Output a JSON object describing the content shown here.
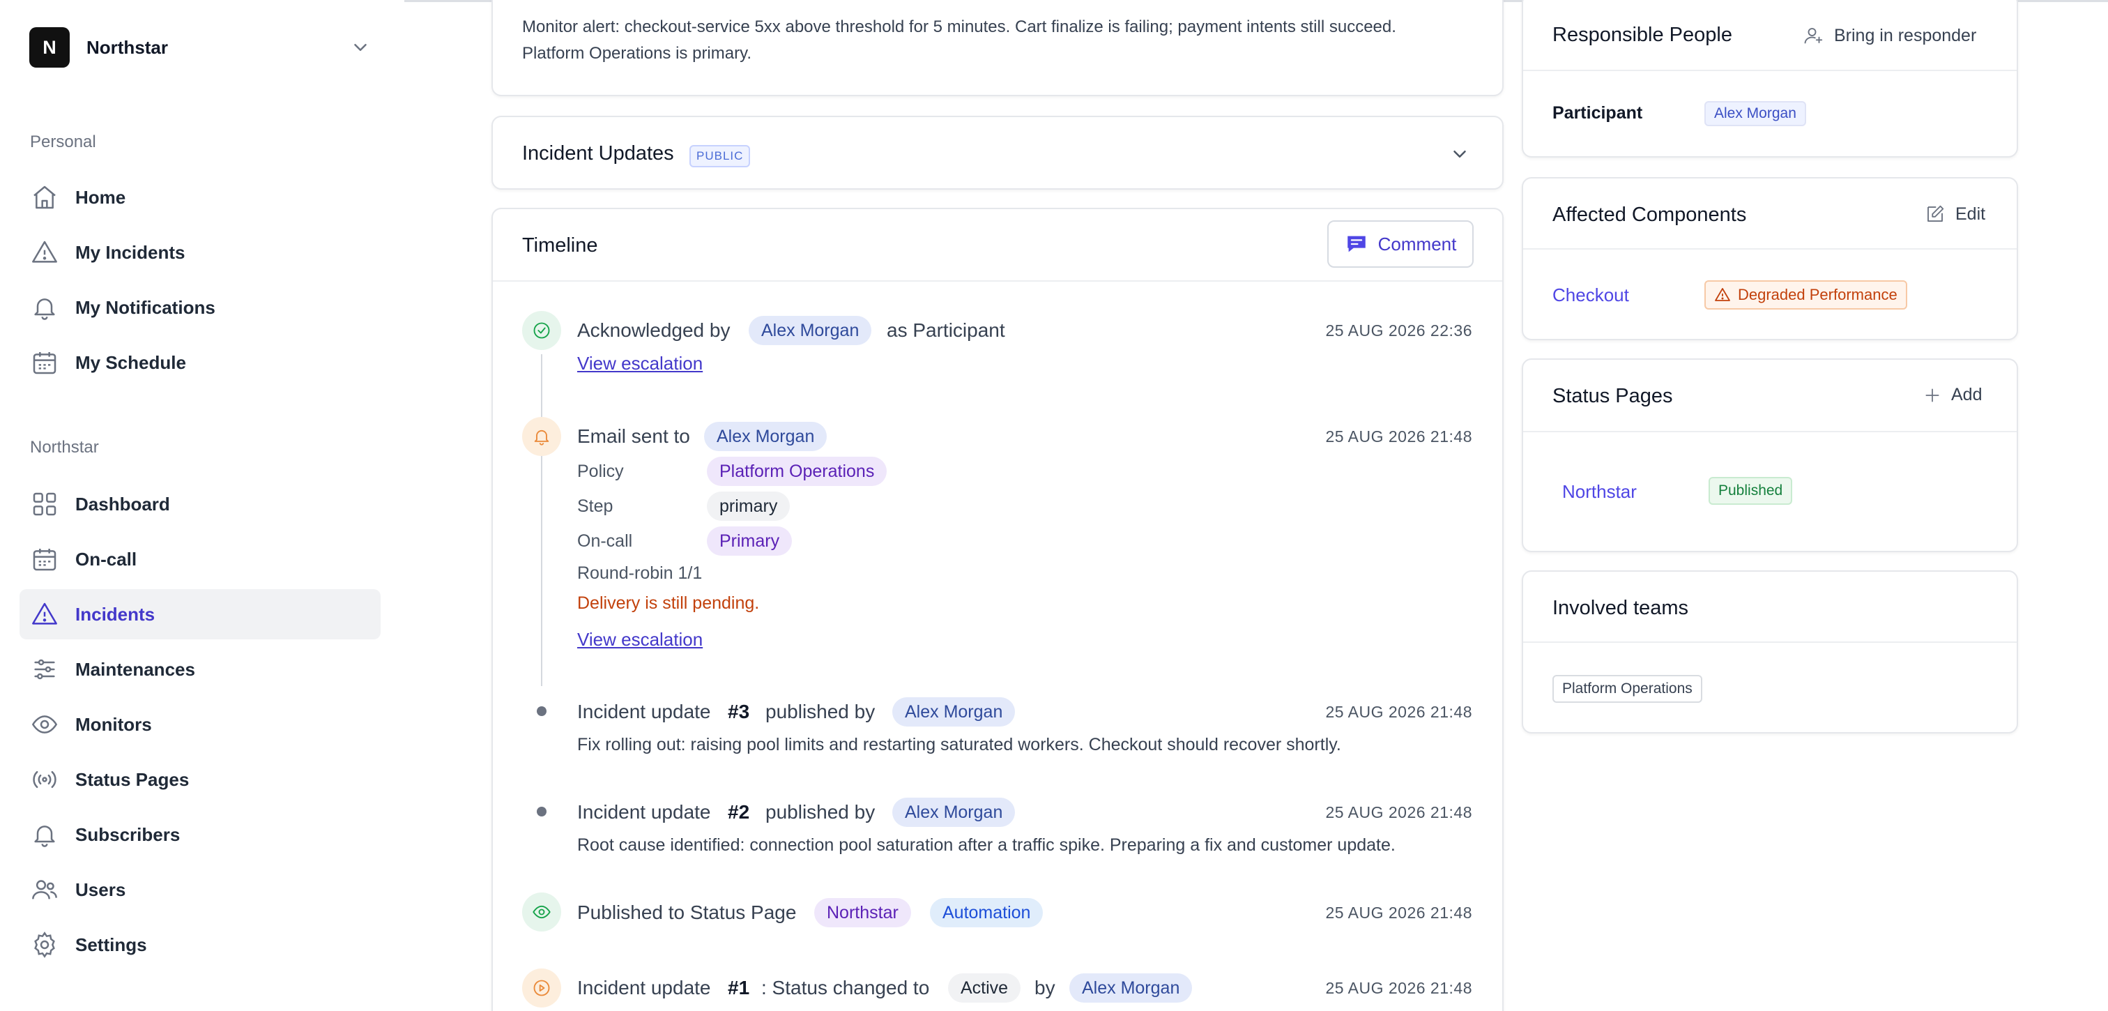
{
  "colors": {
    "accent": "#4338ca",
    "warning": "#c2410c",
    "success": "#15803d"
  },
  "org": {
    "initial": "N",
    "name": "Northstar"
  },
  "sidebar": {
    "personal_label": "Personal",
    "personal_items": [
      {
        "label": "Home",
        "icon": "home-icon"
      },
      {
        "label": "My Incidents",
        "icon": "warning-icon"
      },
      {
        "label": "My Notifications",
        "icon": "bell-icon"
      },
      {
        "label": "My Schedule",
        "icon": "calendar-icon"
      }
    ],
    "org_label": "Northstar",
    "org_items": [
      {
        "label": "Dashboard",
        "icon": "grid-icon"
      },
      {
        "label": "On-call",
        "icon": "calendar-icon"
      },
      {
        "label": "Incidents",
        "icon": "warning-icon",
        "active": true
      },
      {
        "label": "Maintenances",
        "icon": "sliders-icon"
      },
      {
        "label": "Monitors",
        "icon": "eye-icon"
      },
      {
        "label": "Status Pages",
        "icon": "broadcast-icon"
      },
      {
        "label": "Subscribers",
        "icon": "bell-icon"
      },
      {
        "label": "Users",
        "icon": "users-icon"
      },
      {
        "label": "Settings",
        "icon": "gear-icon"
      }
    ]
  },
  "description": {
    "text": "Monitor alert: checkout-service 5xx above threshold for 5 minutes. Cart finalize is failing; payment intents still succeed. Platform Operations is primary."
  },
  "updates": {
    "title": "Incident Updates",
    "badge": "PUBLIC"
  },
  "timeline": {
    "title": "Timeline",
    "comment_label": "Comment",
    "ack": {
      "prefix": "Acknowledged by",
      "user": "Alex Morgan",
      "suffix": "as Participant",
      "date": "25 AUG 2026 22:36",
      "link": "View escalation"
    },
    "email": {
      "prefix": "Email sent to",
      "user": "Alex Morgan",
      "date": "25 AUG 2026 21:48",
      "policy_key": "Policy",
      "policy_value": "Platform Operations",
      "step_key": "Step",
      "step_value": "primary",
      "oncall_key": "On-call",
      "oncall_value": "Primary",
      "round_robin": "Round-robin 1/1",
      "pending": "Delivery is still pending.",
      "link": "View escalation"
    },
    "update3": {
      "prefix": "Incident update",
      "num": "#3",
      "middle": "published by",
      "user": "Alex Morgan",
      "date": "25 AUG 2026 21:48",
      "body": "Fix rolling out: raising pool limits and restarting saturated workers. Checkout should recover shortly."
    },
    "update2": {
      "prefix": "Incident update",
      "num": "#2",
      "middle": "published by",
      "user": "Alex Morgan",
      "date": "25 AUG 2026 21:48",
      "body": "Root cause identified: connection pool saturation after a traffic spike. Preparing a fix and customer update."
    },
    "published": {
      "prefix": "Published to Status Page",
      "page": "Northstar",
      "by": "Automation",
      "date": "25 AUG 2026 21:48"
    },
    "update1": {
      "prefix": "Incident update",
      "num": "#1",
      "middle": ": Status changed to",
      "status": "Active",
      "by": "by",
      "user": "Alex Morgan",
      "date": "25 AUG 2026 21:48"
    }
  },
  "responsible": {
    "title": "Responsible People",
    "action": "Bring in responder",
    "role": "Participant",
    "user": "Alex Morgan"
  },
  "components": {
    "title": "Affected Components",
    "action": "Edit",
    "name": "Checkout",
    "status": "Degraded Performance"
  },
  "status_pages": {
    "title": "Status Pages",
    "action": "Add",
    "name": "Northstar",
    "status": "Published"
  },
  "teams": {
    "title": "Involved teams",
    "team": "Platform Operations"
  }
}
